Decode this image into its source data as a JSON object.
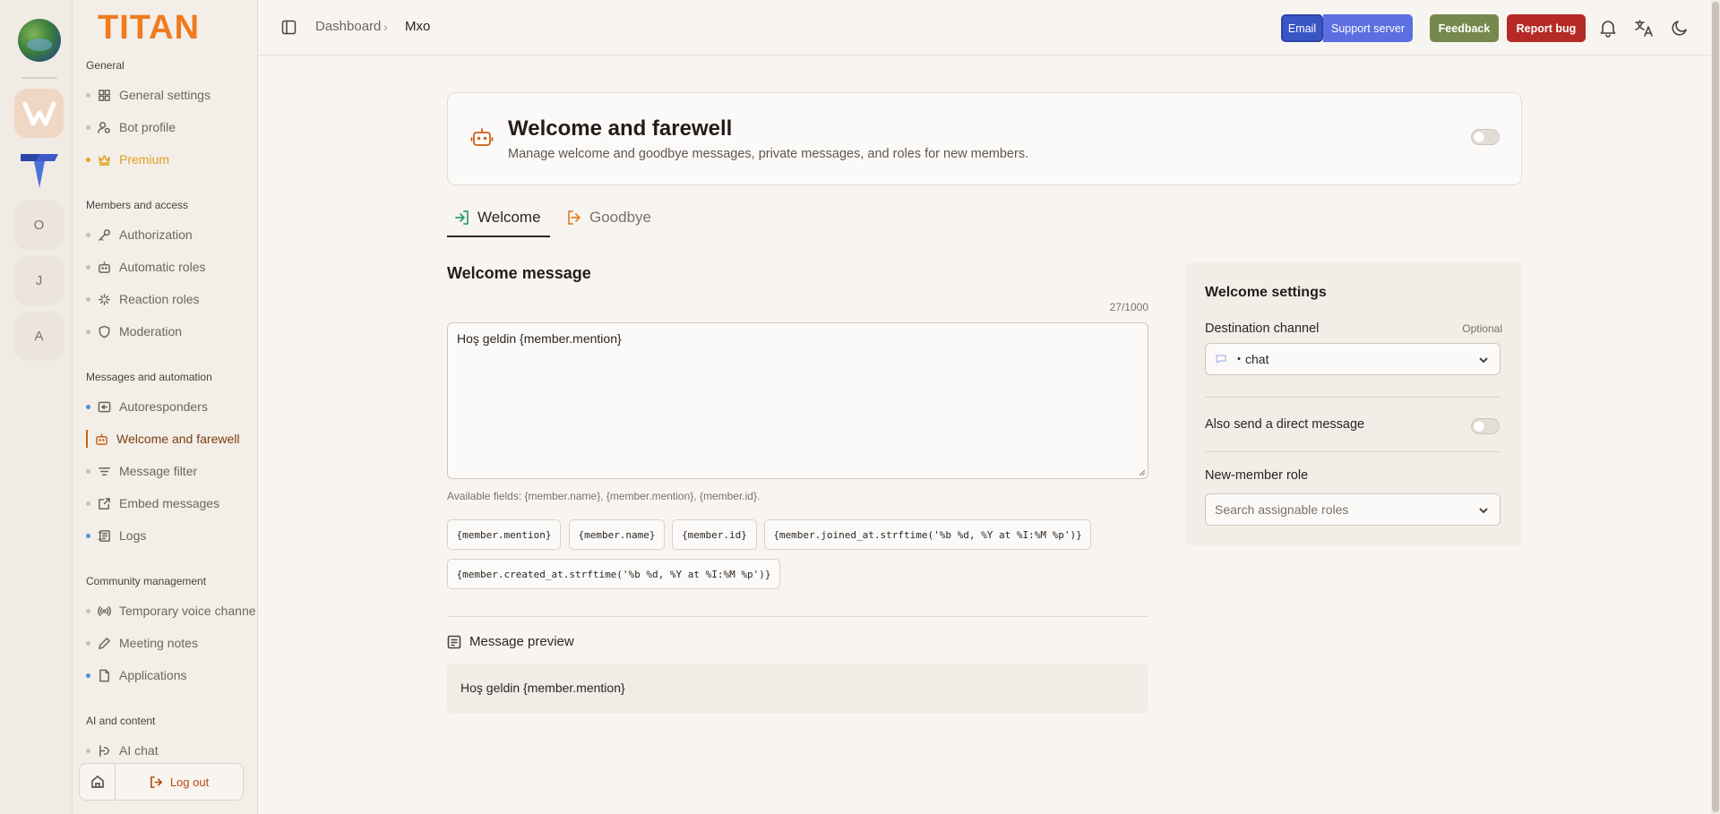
{
  "servers": {
    "letters": [
      "O",
      "J",
      "A"
    ]
  },
  "sidebar": {
    "brand": "TITAN",
    "sections": [
      {
        "title": "General",
        "items": [
          {
            "label": "General settings",
            "icon": "grid-icon"
          },
          {
            "label": "Bot profile",
            "icon": "user-gear-icon"
          },
          {
            "label": "Premium",
            "icon": "crown-icon"
          }
        ]
      },
      {
        "title": "Members and access",
        "items": [
          {
            "label": "Authorization",
            "icon": "key-icon"
          },
          {
            "label": "Automatic roles",
            "icon": "bot-icon"
          },
          {
            "label": "Reaction roles",
            "icon": "sparkle-icon"
          },
          {
            "label": "Moderation",
            "icon": "shield-icon"
          }
        ]
      },
      {
        "title": "Messages and automation",
        "items": [
          {
            "label": "Autoresponders",
            "icon": "message-reply-icon"
          },
          {
            "label": "Welcome and farewell",
            "icon": "bot-icon"
          },
          {
            "label": "Message filter",
            "icon": "filter-icon"
          },
          {
            "label": "Embed messages",
            "icon": "embed-icon"
          },
          {
            "label": "Logs",
            "icon": "logs-icon"
          }
        ]
      },
      {
        "title": "Community management",
        "items": [
          {
            "label": "Temporary voice channels",
            "icon": "radio-icon"
          },
          {
            "label": "Meeting notes",
            "icon": "pen-icon"
          },
          {
            "label": "Applications",
            "icon": "file-icon"
          }
        ]
      },
      {
        "title": "AI and content",
        "items": [
          {
            "label": "AI chat",
            "icon": "ai-chat-icon"
          }
        ]
      }
    ],
    "logout_label": "Log out"
  },
  "topbar": {
    "breadcrumb_root": "Dashboard",
    "breadcrumb_sep": "›",
    "breadcrumb_current": "Mxo",
    "email_label": "Email",
    "support_label": "Support server",
    "feedback_label": "Feedback",
    "bug_label": "Report bug"
  },
  "header": {
    "title": "Welcome and farewell",
    "description": "Manage welcome and goodbye messages, private messages, and roles for new members.",
    "enabled": false
  },
  "tabs": [
    {
      "label": "Welcome",
      "active": true
    },
    {
      "label": "Goodbye",
      "active": false
    }
  ],
  "welcome": {
    "section_title": "Welcome message",
    "counter": "27/1000",
    "message_value": "Hoş geldin {member.mention}",
    "available_fields": "Available fields: {member.name}, {member.mention}, {member.id}.",
    "chips": [
      "{member.mention}",
      "{member.name}",
      "{member.id}",
      "{member.joined_at.strftime('%b %d, %Y at %I:%M %p')}",
      "{member.created_at.strftime('%b %d, %Y at %I:%M %p')}"
    ],
    "preview_title": "Message preview",
    "preview_text": "Hoş geldin {member.mention}"
  },
  "settings": {
    "title": "Welcome settings",
    "destination_label": "Destination channel",
    "destination_optional": "Optional",
    "destination_value": "・chat",
    "dm_label": "Also send a direct message",
    "dm_enabled": false,
    "role_label": "New-member role",
    "role_placeholder": "Search assignable roles"
  },
  "colors": {
    "accent": "#c8621a",
    "premium": "#e0a11a",
    "feedback": "#77884e",
    "report_bug": "#b52a25",
    "support": "#5b6fe0"
  }
}
